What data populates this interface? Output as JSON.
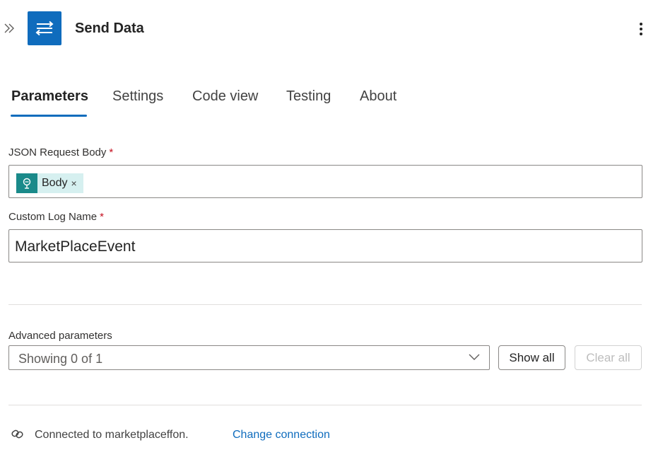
{
  "header": {
    "title": "Send Data",
    "action_icon": "arrows-exchange-icon",
    "accent_color": "#0f6cbd"
  },
  "tabs": [
    {
      "label": "Parameters",
      "active": true
    },
    {
      "label": "Settings",
      "active": false
    },
    {
      "label": "Code view",
      "active": false
    },
    {
      "label": "Testing",
      "active": false
    },
    {
      "label": "About",
      "active": false
    }
  ],
  "fields": {
    "json_request_body": {
      "label": "JSON Request Body",
      "required_mark": "*",
      "token_label": "Body",
      "token_remove": "×",
      "token_color": "#1a8a8a"
    },
    "custom_log_name": {
      "label": "Custom Log Name",
      "required_mark": "*",
      "value": "MarketPlaceEvent"
    }
  },
  "advanced": {
    "label": "Advanced parameters",
    "select_value": "Showing 0 of 1",
    "show_all_label": "Show all",
    "clear_all_label": "Clear all"
  },
  "footer": {
    "connection_text": "Connected to marketplaceffon.",
    "change_connection_label": "Change connection"
  }
}
